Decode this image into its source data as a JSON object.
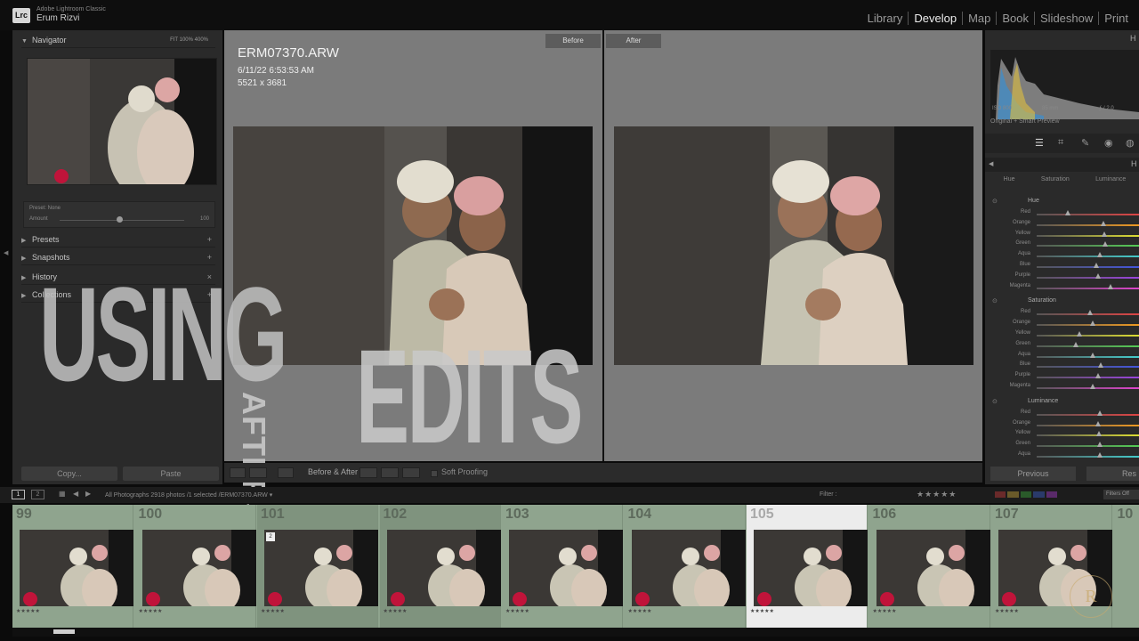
{
  "app": {
    "name": "Adobe Lightroom Classic",
    "user": "Erum Rizvi",
    "logo": "Lrc"
  },
  "modules": [
    "Library",
    "Develop",
    "Map",
    "Book",
    "Slideshow",
    "Print"
  ],
  "active_module": "Develop",
  "left_panel": {
    "navigator": {
      "title": "Navigator",
      "zooms": "FIT  100%  400%"
    },
    "preset_box": {
      "label": "Preset: None",
      "amount_label": "Amount",
      "amount_value": "100"
    },
    "sections": [
      "Presets",
      "Snapshots",
      "History",
      "Collections"
    ],
    "copy_label": "Copy...",
    "paste_label": "Paste"
  },
  "center": {
    "before_label": "Before",
    "after_label": "After",
    "file_name": "ERM07370.ARW",
    "file_date": "6/11/22 6:53:53 AM",
    "file_dims": "5521 x 3681"
  },
  "overlay": {
    "word1": "USING",
    "word2": "AFTERSHOOT",
    "word3": "EDITS"
  },
  "toolbar": {
    "before_after_label": "Before & After :",
    "soft_proofing_label": "Soft Proofing"
  },
  "right_panel": {
    "histogram": {
      "iso": "ISO 800",
      "focal": "85 mm",
      "aperture": "ƒ / 2.0",
      "preview_label": "Original + Smart Preview"
    },
    "hsl": {
      "tabs": [
        "Hue",
        "Saturation",
        "Luminance"
      ],
      "sections": [
        {
          "title": "Hue",
          "sliders": [
            {
              "label": "Red",
              "value": 0.3,
              "color": "#d44"
            },
            {
              "label": "Orange",
              "value": 0.65,
              "color": "#e92"
            },
            {
              "label": "Yellow",
              "value": 0.66,
              "color": "#dd3"
            },
            {
              "label": "Green",
              "value": 0.67,
              "color": "#5c5"
            },
            {
              "label": "Aqua",
              "value": 0.62,
              "color": "#4cc"
            },
            {
              "label": "Blue",
              "value": 0.58,
              "color": "#45d"
            },
            {
              "label": "Purple",
              "value": 0.6,
              "color": "#94d"
            },
            {
              "label": "Magenta",
              "value": 0.72,
              "color": "#d4c"
            }
          ]
        },
        {
          "title": "Saturation",
          "sliders": [
            {
              "label": "Red",
              "value": 0.52,
              "color": "#d44"
            },
            {
              "label": "Orange",
              "value": 0.55,
              "color": "#e92"
            },
            {
              "label": "Yellow",
              "value": 0.42,
              "color": "#dd3"
            },
            {
              "label": "Green",
              "value": 0.38,
              "color": "#5c5"
            },
            {
              "label": "Aqua",
              "value": 0.55,
              "color": "#4cc"
            },
            {
              "label": "Blue",
              "value": 0.63,
              "color": "#45d"
            },
            {
              "label": "Purple",
              "value": 0.6,
              "color": "#94d"
            },
            {
              "label": "Magenta",
              "value": 0.55,
              "color": "#d4c"
            }
          ]
        },
        {
          "title": "Luminance",
          "sliders": [
            {
              "label": "Red",
              "value": 0.62,
              "color": "#d44"
            },
            {
              "label": "Orange",
              "value": 0.6,
              "color": "#e92"
            },
            {
              "label": "Yellow",
              "value": 0.61,
              "color": "#dd3"
            },
            {
              "label": "Green",
              "value": 0.62,
              "color": "#5c5"
            },
            {
              "label": "Aqua",
              "value": 0.62,
              "color": "#4cc"
            }
          ]
        }
      ]
    },
    "previous_label": "Previous",
    "reset_label": "Res"
  },
  "filmstrip_header": {
    "tab1": "1",
    "tab2": "2",
    "breadcrumb": "All Photographs    2918 photos /1 selected /ERM07370.ARW ▾",
    "filter_label": "Filter :",
    "stars": "★★★★★",
    "filters_off": "Filters Off"
  },
  "filmstrip": [
    {
      "num": "99",
      "stars": "★★★★★"
    },
    {
      "num": "100",
      "stars": "★★★★★"
    },
    {
      "num": "101",
      "stars": "★★★★★",
      "badge": "2"
    },
    {
      "num": "102",
      "stars": "★★★★★"
    },
    {
      "num": "103",
      "stars": "★★★★★"
    },
    {
      "num": "104",
      "stars": "★★★★★"
    },
    {
      "num": "105",
      "stars": "★★★★★",
      "selected": true
    },
    {
      "num": "106",
      "stars": "★★★★★"
    },
    {
      "num": "107",
      "stars": "★★★★★"
    },
    {
      "num": "10",
      "stars": ""
    }
  ],
  "colors": {
    "filmstrip_bg": "#8fa48e",
    "center_bg": "#7b7b7b",
    "panel_bg": "#2a2a2a"
  }
}
